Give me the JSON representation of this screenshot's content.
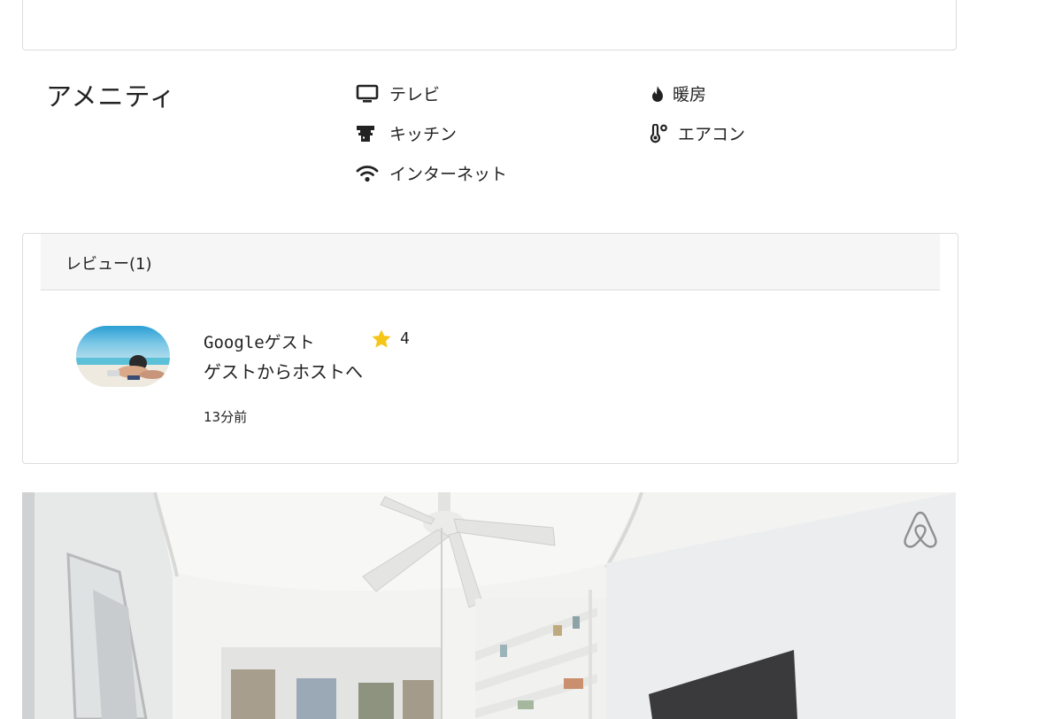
{
  "amenities": {
    "title": "アメニティ",
    "items": [
      {
        "icon": "tv-icon",
        "label": "テレビ"
      },
      {
        "icon": "fire-icon",
        "label": "暖房"
      },
      {
        "icon": "kitchen-icon",
        "label": "キッチン"
      },
      {
        "icon": "thermometer-icon",
        "label": "エアコン"
      },
      {
        "icon": "wifi-icon",
        "label": "インターネット"
      }
    ]
  },
  "reviews": {
    "header": "レビュー(1)",
    "items": [
      {
        "reviewer": "Googleゲスト",
        "rating": "4",
        "text": "ゲストからホストへ",
        "time": "13分前"
      }
    ]
  },
  "colors": {
    "star": "#f5c518",
    "border": "#dcdcdc",
    "header_bg": "#f6f6f6"
  },
  "photo": {
    "logo_icon": "airbnb-logo-icon"
  }
}
